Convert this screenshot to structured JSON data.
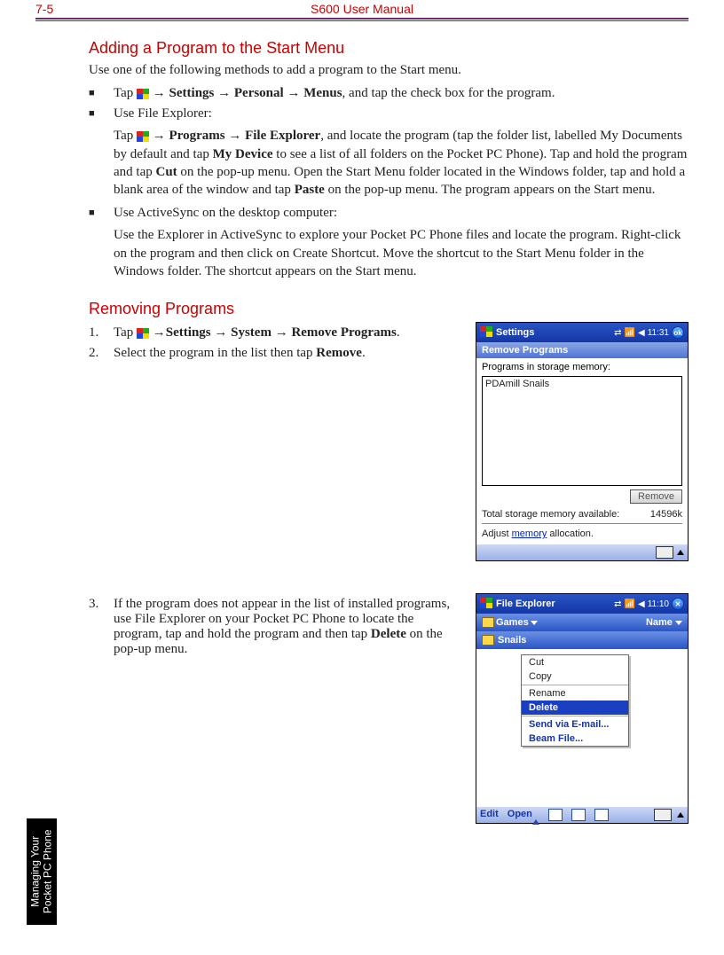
{
  "header": {
    "page_no": "7-5",
    "title": "S600 User Manual"
  },
  "section1": {
    "heading": "Adding a Program to the Start Menu",
    "intro": "Use one of the following methods to add a program to the Start menu.",
    "b1_pre": "Tap ",
    "b1_post": " → Settings → Personal → Menus",
    "b1_tail": ", and tap the check box for the program.",
    "b2": "Use File Explorer:",
    "b2_sub_pre": "Tap ",
    "b2_sub_mid1": " → Programs → File Explorer",
    "b2_sub_tail1": ", and locate the program (tap the folder list, labelled My Documents by default and tap ",
    "b2_sub_bold2": "My Device",
    "b2_sub_tail2": " to see a list of all folders on the Pocket PC Phone). Tap and hold the program and tap ",
    "b2_sub_bold3": "Cut",
    "b2_sub_tail3": " on the pop-up menu. Open the Start Menu folder located in the Windows folder, tap and hold a blank area of the window and tap ",
    "b2_sub_bold4": "Paste",
    "b2_sub_tail4": " on the pop-up menu. The program appears on the Start menu.",
    "b3": "Use ActiveSync on the desktop computer:",
    "b3_sub": "Use the Explorer in ActiveSync to explore your Pocket PC Phone files and locate the program. Right-click on the program and then click on Create Shortcut. Move the shortcut to the Start Menu folder in the Windows folder. The shortcut appears on the Start menu."
  },
  "section2": {
    "heading": "Removing Programs",
    "s1_pre": "Tap ",
    "s1_bold": " →Settings → System → Remove Programs",
    "s1_tail": ".",
    "s2_pre": "Select the program in the list then tap ",
    "s2_bold": "Remove",
    "s2_tail": ".",
    "s3_pre": "If the program does not appear in the list of installed programs, use File Explorer on your Pocket PC Phone to locate the program, tap and hold the program and then tap ",
    "s3_bold": "Delete",
    "s3_tail": " on the pop-up menu."
  },
  "shot1": {
    "title": "Settings",
    "time": "11:31",
    "ok": "ok",
    "subtitle": "Remove Programs",
    "label": "Programs in storage memory:",
    "item": "PDAmill Snails",
    "btn": "Remove",
    "total_lbl": "Total storage memory available:",
    "total_val": "14596k",
    "adjust_pre": "Adjust ",
    "adjust_link": "memory",
    "adjust_post": " allocation."
  },
  "shot2": {
    "title": "File Explorer",
    "time": "11:10",
    "crumb_left": "Games",
    "crumb_right": "Name",
    "folder": "Snails",
    "menu": {
      "cut": "Cut",
      "copy": "Copy",
      "rename": "Rename",
      "delete": "Delete",
      "send": "Send via E-mail...",
      "beam": "Beam File..."
    },
    "edit": "Edit",
    "open": "Open"
  },
  "sidetab": {
    "line1": "Managing Your",
    "line2": "Pocket PC Phone"
  }
}
